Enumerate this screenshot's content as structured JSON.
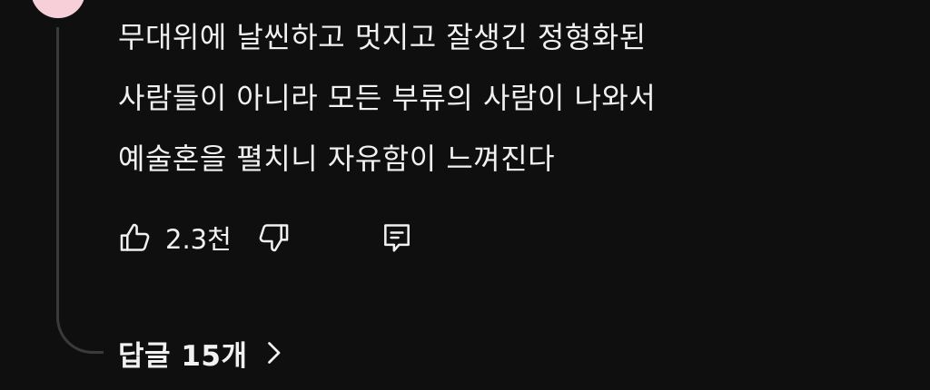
{
  "comment": {
    "lines": [
      "무대위에 날씬하고 멋지고 잘생긴 정형화된",
      "사람들이 아니라 모든 부류의 사람이 나와서",
      "예술혼을 펼치니 자유함이 느껴진다"
    ]
  },
  "actions": {
    "like_count": "2.3천"
  },
  "replies": {
    "label": "답글 15개"
  },
  "icons": {
    "like": "thumbs-up-icon",
    "dislike": "thumbs-down-icon",
    "reply": "comment-icon",
    "expand": "chevron-right-icon"
  },
  "colors": {
    "background": "#0f0f0f",
    "text": "#f1f1f1",
    "thread_line": "#3a3a3a",
    "avatar": "#f6cfd8"
  }
}
